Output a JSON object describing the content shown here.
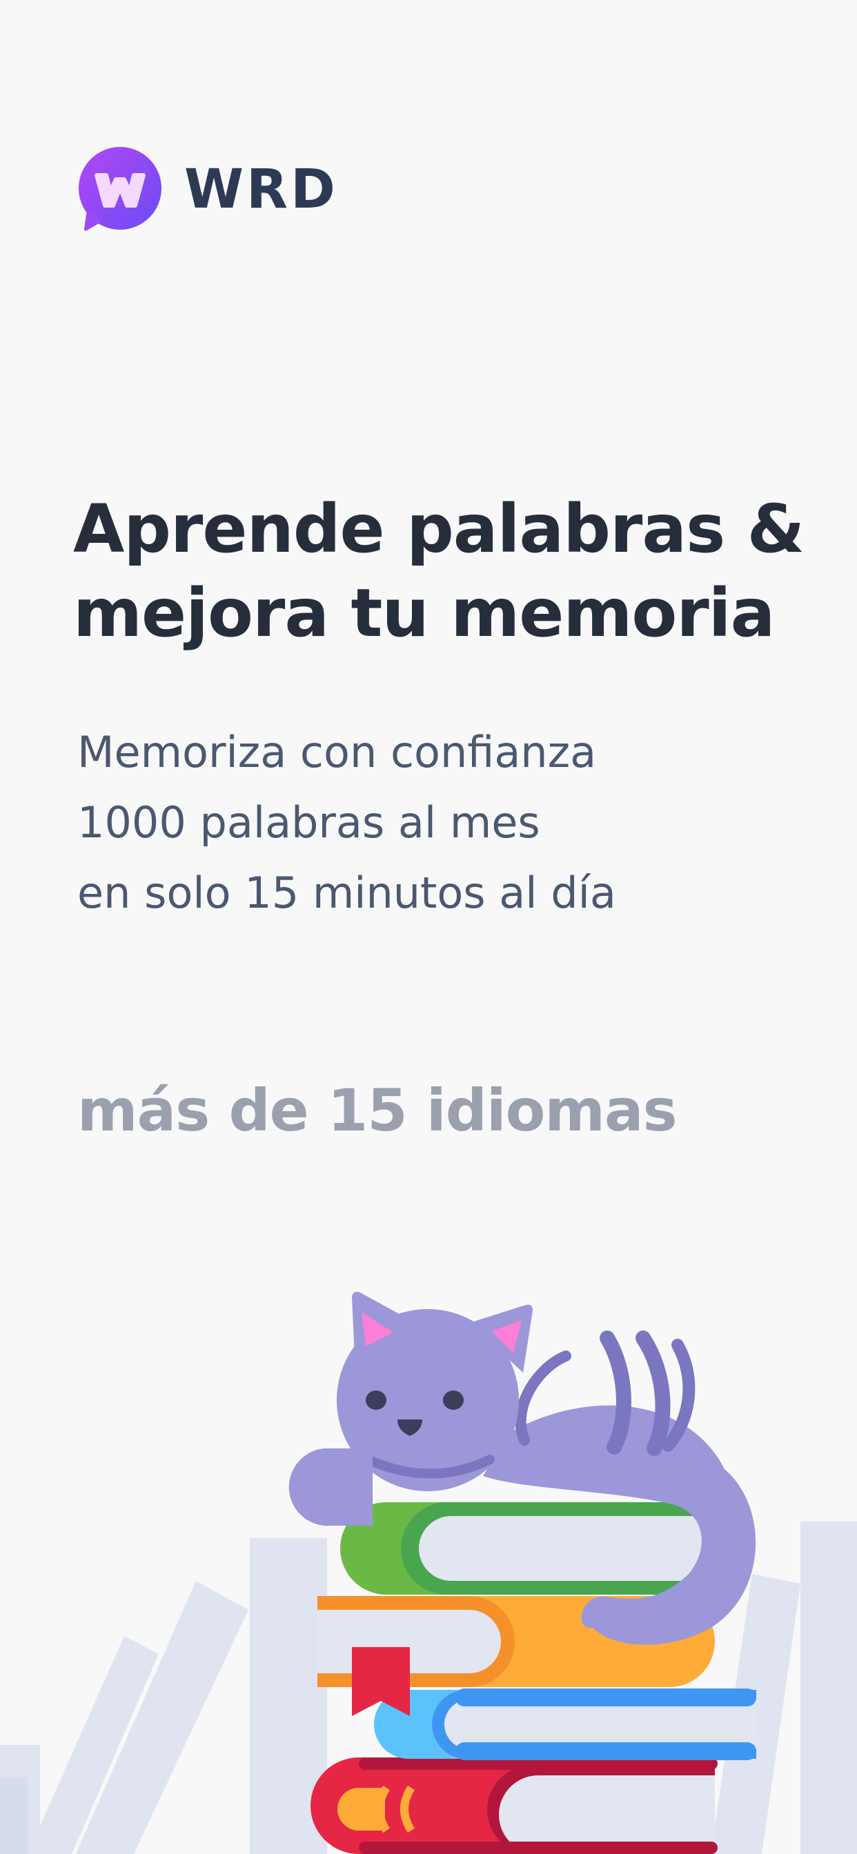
{
  "brand": {
    "name": "WRD",
    "logo_icon": "speech-bubble-w-icon",
    "logo_gradient": [
      "#b347f5",
      "#6a4cf5"
    ]
  },
  "hero": {
    "headline_line1": "Aprende palabras &",
    "headline_line2": "mejora tu memoria",
    "subtitle_lines": [
      "Memoriza con confianza",
      "1000 palabras al mes",
      "en solo 15 minutos al día"
    ],
    "languages_note": "más de 15 idiomas"
  },
  "illustration": {
    "subject": "cat-on-books-icon",
    "colors": {
      "cat": "#9b97d9",
      "cat_stripes": "#7b76c0",
      "book_green": "#6ab947",
      "book_orange": "#ffab37",
      "book_blue": "#4da8f5",
      "book_red": "#e52645",
      "background_books": "#dfe4f0"
    }
  }
}
